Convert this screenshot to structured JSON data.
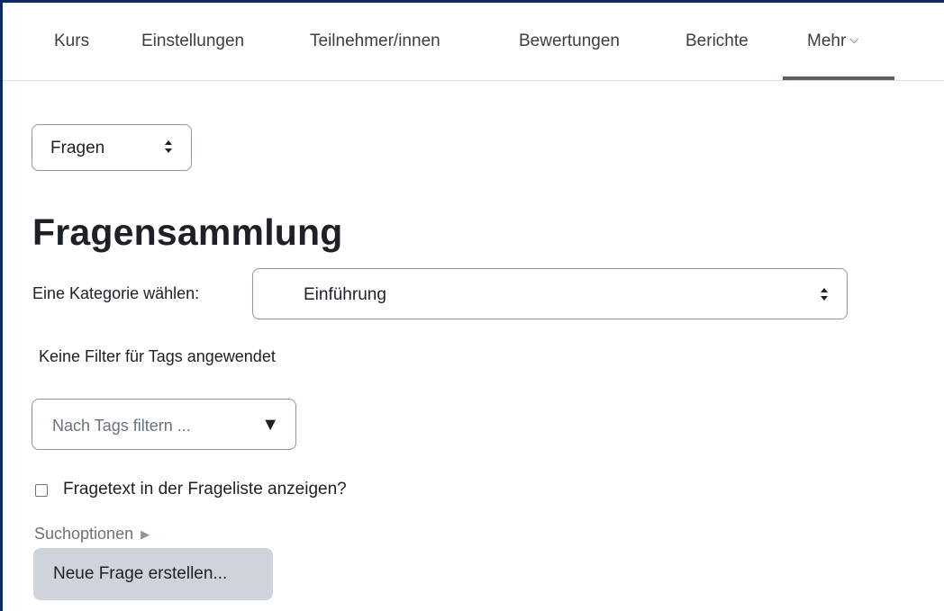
{
  "nav": {
    "items": [
      {
        "label": "Kurs"
      },
      {
        "label": "Einstellungen"
      },
      {
        "label": "Teilnehmer/innen"
      },
      {
        "label": "Bewertungen"
      },
      {
        "label": "Berichte"
      },
      {
        "label": "Mehr"
      }
    ],
    "active": "Mehr"
  },
  "page_select": {
    "value": "Fragen"
  },
  "page_title": "Fragensammlung",
  "category": {
    "label": "Eine Kategorie wählen:",
    "value": "Einführung"
  },
  "tags": {
    "status_text": "Keine Filter für Tags angewendet",
    "placeholder": "Nach Tags filtern ..."
  },
  "show_question_text": {
    "label": "Fragetext in der Frageliste anzeigen?",
    "checked": false
  },
  "search_options": {
    "label": "Suchoptionen"
  },
  "create_button": {
    "label": "Neue Frage erstellen..."
  },
  "colors": {
    "frame": "#0f2a5c",
    "button_bg": "#ced4da",
    "active_underline": "#5a5f63"
  }
}
